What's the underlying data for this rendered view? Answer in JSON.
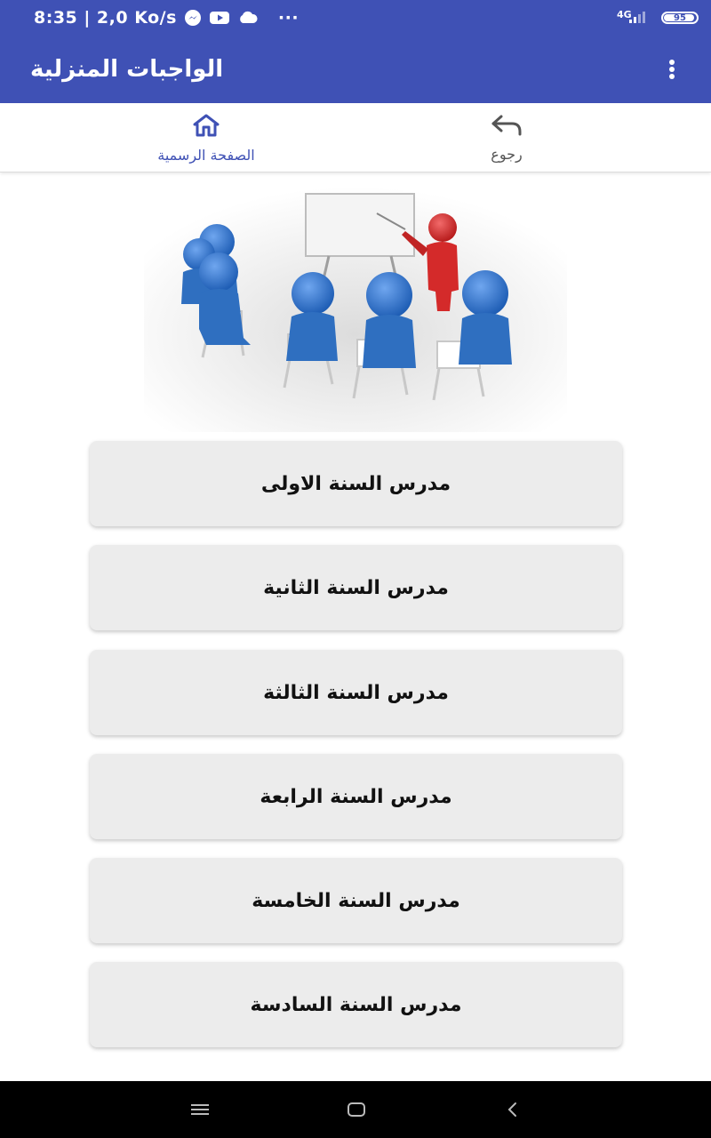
{
  "status_bar": {
    "time_speed": "8:35 | 2,0 Ko/s",
    "dots": "···",
    "network": "4G",
    "battery": "95",
    "battery_level": 0.95,
    "icons": [
      "messenger-icon",
      "youtube-icon",
      "cloud-icon",
      "signal-icon",
      "battery-icon"
    ]
  },
  "app_bar": {
    "title": "الواجبات المنزلية",
    "menu_icon": "more-vert-icon"
  },
  "toolbar": {
    "home_label": "الصفحة الرسمية",
    "home_icon": "home-icon",
    "back_label": "رجوع",
    "back_icon": "undo-arrow-icon"
  },
  "hero": {
    "icon": "classroom-illustration"
  },
  "grades": [
    {
      "label": "مدرس السنة الاولى"
    },
    {
      "label": "مدرس السنة الثانية"
    },
    {
      "label": "مدرس السنة الثالثة"
    },
    {
      "label": "مدرس السنة الرابعة"
    },
    {
      "label": "مدرس السنة الخامسة"
    },
    {
      "label": "مدرس السنة السادسة"
    }
  ],
  "nav_bar": {
    "icons": [
      "menu-icon",
      "home-square-icon",
      "back-chevron-icon"
    ]
  },
  "colors": {
    "primary": "#3f51b5",
    "button_bg": "#ececec",
    "figure_blue": "#2f6fc0",
    "figure_red": "#d42a2a"
  }
}
